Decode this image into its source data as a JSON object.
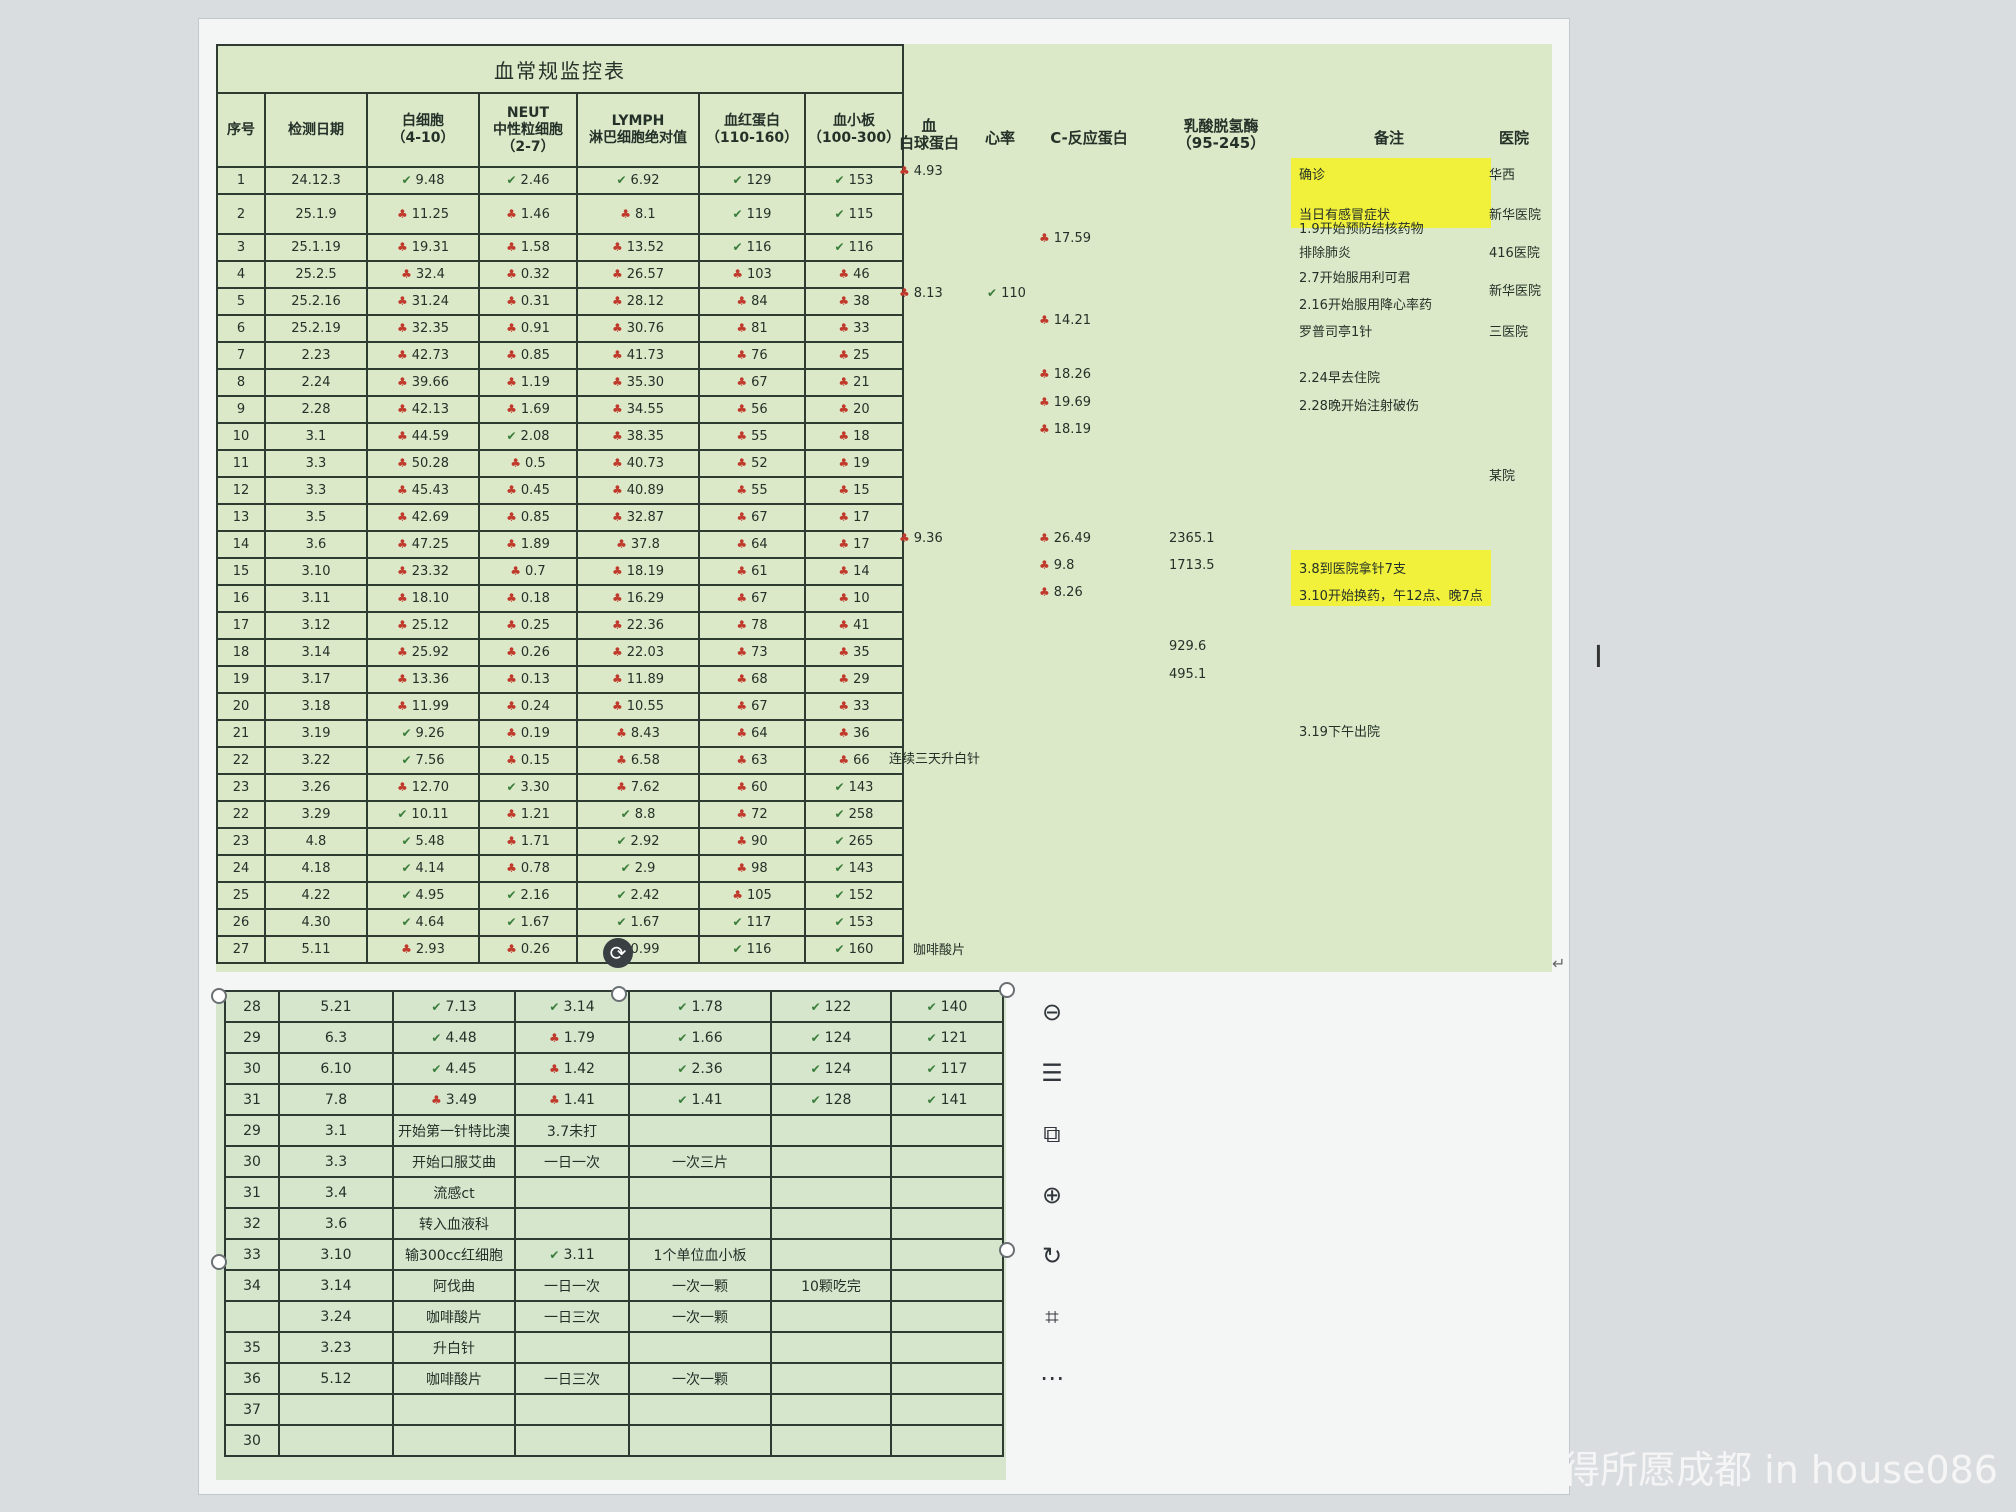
{
  "table": {
    "title": "血常规监控表",
    "headers": [
      "序号",
      "检测日期",
      "白细胞\n（4-10）",
      "NEUT\n中性粒细胞\n（2-7）",
      "LYMPH\n淋巴细胞绝对值",
      "血红蛋白\n（110-160）",
      "血小板\n（100-300）"
    ],
    "rows": [
      [
        "1",
        "24.12.3",
        "9.48",
        "2.46",
        "6.92",
        "129",
        "153"
      ],
      [
        "2",
        "25.1.9",
        "11.25",
        "1.46",
        "8.1",
        "119",
        "115"
      ],
      [
        "3",
        "25.1.19",
        "19.31",
        "1.58",
        "13.52",
        "116",
        "116"
      ],
      [
        "4",
        "25.2.5",
        "32.4",
        "0.32",
        "26.57",
        "103",
        "46"
      ],
      [
        "5",
        "25.2.16",
        "31.24",
        "0.31",
        "28.12",
        "84",
        "38"
      ],
      [
        "6",
        "25.2.19",
        "32.35",
        "0.91",
        "30.76",
        "81",
        "33"
      ],
      [
        "7",
        "2.23",
        "42.73",
        "0.85",
        "41.73",
        "76",
        "25"
      ],
      [
        "8",
        "2.24",
        "39.66",
        "1.19",
        "35.30",
        "67",
        "21"
      ],
      [
        "9",
        "2.28",
        "42.13",
        "1.69",
        "34.55",
        "56",
        "20"
      ],
      [
        "10",
        "3.1",
        "44.59",
        "2.08",
        "38.35",
        "55",
        "18"
      ],
      [
        "11",
        "3.3",
        "50.28",
        "0.5",
        "40.73",
        "52",
        "19"
      ],
      [
        "12",
        "3.3",
        "45.43",
        "0.45",
        "40.89",
        "55",
        "15"
      ],
      [
        "13",
        "3.5",
        "42.69",
        "0.85",
        "32.87",
        "67",
        "17"
      ],
      [
        "14",
        "3.6",
        "47.25",
        "1.89",
        "37.8",
        "64",
        "17"
      ],
      [
        "15",
        "3.10",
        "23.32",
        "0.7",
        "18.19",
        "61",
        "14"
      ],
      [
        "16",
        "3.11",
        "18.10",
        "0.18",
        "16.29",
        "67",
        "10"
      ],
      [
        "17",
        "3.12",
        "25.12",
        "0.25",
        "22.36",
        "78",
        "41"
      ],
      [
        "18",
        "3.14",
        "25.92",
        "0.26",
        "22.03",
        "73",
        "35"
      ],
      [
        "19",
        "3.17",
        "13.36",
        "0.13",
        "11.89",
        "68",
        "29"
      ],
      [
        "20",
        "3.18",
        "11.99",
        "0.24",
        "10.55",
        "67",
        "33"
      ],
      [
        "21",
        "3.19",
        "9.26",
        "0.19",
        "8.43",
        "64",
        "36"
      ],
      [
        "22",
        "3.22",
        "7.56",
        "0.15",
        "6.58",
        "63",
        "66"
      ],
      [
        "23",
        "3.26",
        "12.70",
        "3.30",
        "7.62",
        "60",
        "143"
      ],
      [
        "22",
        "3.29",
        "10.11",
        "1.21",
        "8.8",
        "72",
        "258"
      ],
      [
        "23",
        "4.8",
        "5.48",
        "1.71",
        "2.92",
        "90",
        "265"
      ],
      [
        "24",
        "4.18",
        "4.14",
        "0.78",
        "2.9",
        "98",
        "143"
      ],
      [
        "25",
        "4.22",
        "4.95",
        "2.16",
        "2.42",
        "105",
        "152"
      ],
      [
        "26",
        "4.30",
        "4.64",
        "1.67",
        "1.67",
        "117",
        "153"
      ],
      [
        "27",
        "5.11",
        "2.93",
        "0.26",
        "0.99",
        "116",
        "160"
      ]
    ],
    "marks": [
      [
        "ok",
        "ok",
        "ok",
        "ok",
        "ok"
      ],
      [
        "high",
        "high",
        "high",
        "ok",
        "ok"
      ],
      [
        "high",
        "high",
        "high",
        "ok",
        "ok"
      ],
      [
        "high",
        "high",
        "high",
        "high",
        "high"
      ],
      [
        "high",
        "high",
        "high",
        "high",
        "high"
      ],
      [
        "high",
        "high",
        "high",
        "high",
        "high"
      ],
      [
        "high",
        "high",
        "high",
        "high",
        "high"
      ],
      [
        "high",
        "high",
        "high",
        "high",
        "high"
      ],
      [
        "high",
        "high",
        "high",
        "high",
        "high"
      ],
      [
        "high",
        "ok",
        "high",
        "high",
        "high"
      ],
      [
        "high",
        "high",
        "high",
        "high",
        "high"
      ],
      [
        "high",
        "high",
        "high",
        "high",
        "high"
      ],
      [
        "high",
        "high",
        "high",
        "high",
        "high"
      ],
      [
        "high",
        "high",
        "high",
        "high",
        "high"
      ],
      [
        "high",
        "high",
        "high",
        "high",
        "high"
      ],
      [
        "high",
        "high",
        "high",
        "high",
        "high"
      ],
      [
        "high",
        "high",
        "high",
        "high",
        "high"
      ],
      [
        "high",
        "high",
        "high",
        "high",
        "high"
      ],
      [
        "high",
        "high",
        "high",
        "high",
        "high"
      ],
      [
        "high",
        "high",
        "high",
        "high",
        "high"
      ],
      [
        "ok",
        "high",
        "high",
        "high",
        "high"
      ],
      [
        "ok",
        "high",
        "high",
        "high",
        "high"
      ],
      [
        "high",
        "ok",
        "high",
        "high",
        "ok"
      ],
      [
        "ok",
        "high",
        "ok",
        "high",
        "ok"
      ],
      [
        "ok",
        "high",
        "ok",
        "high",
        "ok"
      ],
      [
        "ok",
        "high",
        "ok",
        "high",
        "ok"
      ],
      [
        "ok",
        "ok",
        "ok",
        "high",
        "ok"
      ],
      [
        "ok",
        "ok",
        "ok",
        "ok",
        "ok"
      ],
      [
        "high",
        "high",
        "ok",
        "ok",
        "ok"
      ]
    ]
  },
  "right": {
    "headers": [
      "血\n白球蛋白",
      "心率",
      "C-反应蛋白",
      "乳酸脱氢酶\n（95-245）",
      "备注",
      "医院"
    ],
    "globulin": [
      {
        "row": 1,
        "v": "4.93"
      },
      {
        "row": 5,
        "v": "8.13"
      },
      {
        "row": 14,
        "v": "9.36"
      }
    ],
    "heart": [
      {
        "row": 5,
        "v": "110"
      }
    ],
    "crp": [
      {
        "row": 3,
        "v": "17.59"
      },
      {
        "row": 6,
        "v": "14.21"
      },
      {
        "row": 8,
        "v": "18.26"
      },
      {
        "row": 9,
        "v": "19.69"
      },
      {
        "row": 10,
        "v": "18.19"
      },
      {
        "row": 14,
        "v": "26.49"
      },
      {
        "row": 15,
        "v": "9.8"
      },
      {
        "row": 16,
        "v": "8.26"
      }
    ],
    "ldh": [
      {
        "row": 14,
        "v": "2365.1"
      },
      {
        "row": 15,
        "v": "1713.5"
      },
      {
        "row": 18,
        "v": "929.6"
      },
      {
        "row": 19,
        "v": "495.1"
      }
    ],
    "notes": [
      {
        "row": 1,
        "v": "确诊"
      },
      {
        "row": 2,
        "v": "当日有感冒症状"
      },
      {
        "row": 2.5,
        "v": "1.9开始预防结核药物"
      },
      {
        "row": 3.4,
        "v": "排除肺炎"
      },
      {
        "row": 4.3,
        "v": "2.7开始服用利可君"
      },
      {
        "row": 5.3,
        "v": "2.16开始服用降心率药"
      },
      {
        "row": 6.3,
        "v": "罗普司亭1针"
      },
      {
        "row": 8,
        "v": "2.24早去住院"
      },
      {
        "row": 9,
        "v": "2.28晚开始注射破伤"
      },
      {
        "row": 15,
        "v": "3.8到医院拿针7支"
      },
      {
        "row": 16,
        "v": "3.10开始换药，午12点、晚7点"
      },
      {
        "row": 21,
        "v": "3.19下午出院"
      }
    ],
    "hospital": [
      {
        "row": 1,
        "v": "华西"
      },
      {
        "row": 2,
        "v": "新华医院"
      },
      {
        "row": 3.4,
        "v": "416医院"
      },
      {
        "row": 4.8,
        "v": "新华医院"
      },
      {
        "row": 6.3,
        "v": "三医院"
      },
      {
        "row": 11.6,
        "v": "某院"
      }
    ],
    "row22_note": "连续三天升白针",
    "row27_note": "咖啡酸片"
  },
  "lower": {
    "rows": [
      [
        "28",
        "5.21",
        "7.13",
        "3.14",
        "1.78",
        "122",
        "140"
      ],
      [
        "29",
        "6.3",
        "4.48",
        "1.79",
        "1.66",
        "124",
        "121"
      ],
      [
        "30",
        "6.10",
        "4.45",
        "1.42",
        "2.36",
        "124",
        "117"
      ],
      [
        "31",
        "7.8",
        "3.49",
        "1.41",
        "1.41",
        "128",
        "141"
      ],
      [
        "29",
        "3.1",
        "开始第一针特比澳",
        "3.7未打",
        "",
        "",
        ""
      ],
      [
        "30",
        "3.3",
        "开始口服艾曲",
        "一日一次",
        "一次三片",
        "",
        ""
      ],
      [
        "31",
        "3.4",
        "流感ct",
        "",
        "",
        "",
        ""
      ],
      [
        "32",
        "3.6",
        "转入血液科",
        "",
        "",
        "",
        ""
      ],
      [
        "33",
        "3.10",
        "输300cc红细胞",
        "3.11",
        "1个单位血小板",
        "",
        ""
      ],
      [
        "34",
        "3.14",
        "阿伐曲",
        "一日一次",
        "一次一颗",
        "10颗吃完",
        ""
      ],
      [
        "",
        "3.24",
        "咖啡酸片",
        "一日三次",
        "一次一颗",
        "",
        ""
      ],
      [
        "35",
        "3.23",
        "升白针",
        "",
        "",
        "",
        ""
      ],
      [
        "36",
        "5.12",
        "咖啡酸片",
        "一日三次",
        "一次一颗",
        "",
        ""
      ],
      [
        "37",
        "",
        "",
        "",
        "",
        "",
        ""
      ],
      [
        "30",
        "",
        "",
        "",
        "",
        "",
        ""
      ]
    ],
    "marks": [
      [
        "ok",
        "ok",
        "ok",
        "ok",
        "ok"
      ],
      [
        "ok",
        "high",
        "ok",
        "ok",
        "ok"
      ],
      [
        "ok",
        "high",
        "ok",
        "ok",
        "ok"
      ],
      [
        "high",
        "high",
        "ok",
        "ok",
        "ok"
      ],
      [
        "",
        "",
        "",
        "",
        ""
      ],
      [
        "",
        "",
        "",
        "",
        ""
      ],
      [
        "",
        "",
        "",
        "",
        ""
      ],
      [
        "",
        "",
        "",
        "",
        ""
      ],
      [
        "",
        "ok",
        "",
        "",
        ""
      ],
      [
        "",
        "",
        "",
        "",
        ""
      ],
      [
        "",
        "",
        "",
        "",
        ""
      ],
      [
        "",
        "",
        "",
        "",
        ""
      ],
      [
        "",
        "",
        "",
        "",
        ""
      ],
      [
        "",
        "",
        "",
        "",
        ""
      ],
      [
        "",
        "",
        "",
        "",
        ""
      ]
    ]
  },
  "toolbar": {
    "icons": [
      "zoom-out-icon",
      "text-wrap-icon",
      "crop-icon",
      "zoom-in-icon",
      "rotate-icon",
      "ocr-icon",
      "more-icon"
    ],
    "glyphs": [
      "⊖",
      "☰",
      "⧉",
      "⊕",
      "↻",
      "⌗",
      "⋯"
    ]
  },
  "watermark": "@得所愿成都 in house086",
  "para_mark": "↵",
  "cursor": "I",
  "check_glyph": "✔",
  "high_glyph": "♣"
}
